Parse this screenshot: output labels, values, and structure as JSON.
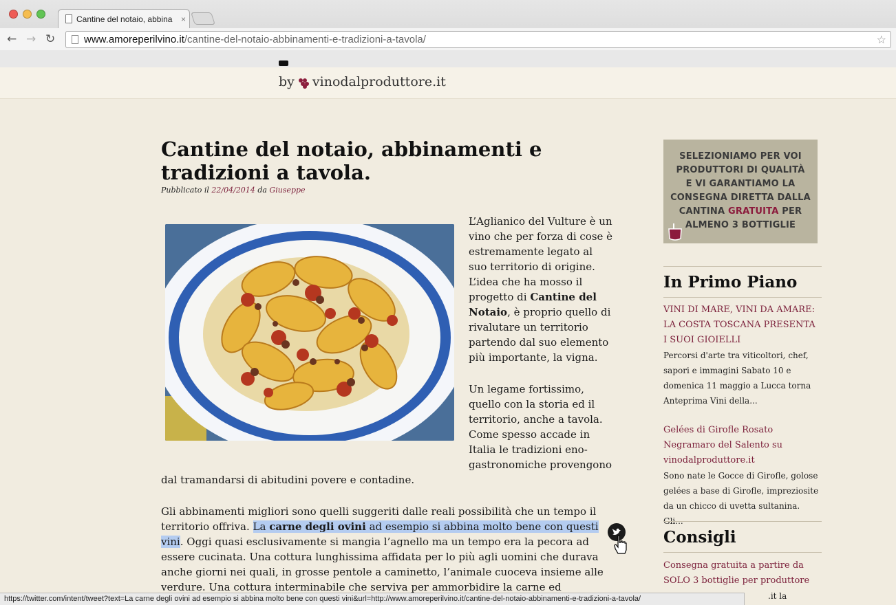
{
  "browser": {
    "tab_title": "Cantine del notaio, abbina",
    "tab_close": "×",
    "url_host": "www.amoreperilvino.it",
    "url_path": "/cantine-del-notaio-abbinamenti-e-tradizioni-a-tavola/",
    "back_icon": "←",
    "forward_icon": "→",
    "reload_icon": "↻",
    "star_icon": "☆"
  },
  "site": {
    "brand_by": "by",
    "brand_name": "vinodalproduttore.it"
  },
  "article": {
    "title": "Cantine del notaio, abbinamenti e tradizioni a tavola.",
    "meta_prefix": "Pubblicato il",
    "date": "22/04/2014",
    "meta_by": "da",
    "author": "Giuseppe",
    "p1_a": "L’Aglianico del Vulture è un vino che per forza di cose è estremamente legato al suo territorio di origine. L’idea che ha mosso il progetto di",
    "p1_bold": "Cantine del Notaio",
    "p1_b": ", è proprio quello di rivalutare un territorio partendo dal suo elemento più importante, la vigna.",
    "p2_col": "Un legame fortissimo, quello con la storia ed il territorio, anche a tavola. Come spesso accade in Italia le tradizioni eno-gastronomiche provengono",
    "p2_tail": "dal tramandarsi di abitudini povere e contadine.",
    "p3_a": "Gli abbinamenti migliori sono quelli suggeriti dalle reali possibilità che un tempo il territorio offriva.",
    "p3_hl_a": "La",
    "p3_hl_bold": "carne degli ovini",
    "p3_hl_b": "ad esempio si abbina molto bene con questi vini",
    "p3_b": ". Oggi quasi esclusivamente si mangia l’agnello ma un tempo era la pecora ad essere cucinata. Una cottura lunghissima affidata per lo più agli uomini che durava anche giorni nei quali, in grosse pentole a caminetto, l’animale cuoceva insieme alle verdure. Una cottura interminabile che serviva per ammorbidire la carne ed eliminare il tipico forte"
  },
  "promo": {
    "line1": "SELEZIONIAMO PER VOI",
    "line2": "PRODUTTORI DI QUALITÀ",
    "line3": "E VI GARANTIAMO LA",
    "line4": "CONSEGNA DIRETTA DALLA",
    "line5_a": "CANTINA",
    "line5_accent": "GRATUITA",
    "line5_b": "PER",
    "line6": "ALMENO 3 BOTTIGLIE"
  },
  "sidebar": {
    "primo_heading": "In Primo Piano",
    "post1_title": "VINI DI MARE, VINI DA AMARE: LA COSTA TOSCANA PRESENTA I SUOI GIOIELLI",
    "post1_excerpt": "Percorsi d'arte tra viticoltori, chef, sapori e immagini Sabato 10 e domenica 11 maggio a Lucca torna Anteprima Vini della...",
    "post2_title": "Gelées di Girofle Rosato Negramaro del Salento su vinodalproduttore.it",
    "post2_excerpt": "Sono nate le Gocce di Girofle, golose gelées a base di Girofle, impreziosite da un chicco di uvetta sultanina. Gli...",
    "consigli_heading": "Consigli",
    "consiglio1_title": "Consegna gratuita a partire da SOLO 3 bottiglie per produttore",
    "consiglio1_excerpt": ".it la consegna è"
  },
  "status_url": "https://twitter.com/intent/tweet?text=La carne degli ovini ad esempio si abbina molto bene con questi vini&url=http://www.amoreperilvino.it/cantine-del-notaio-abbinamenti-e-tradizioni-a-tavola/",
  "tweet_icon": "twitter-bird-icon",
  "colors": {
    "accent": "#7b1f3a",
    "page_bg": "#f1ece0",
    "selection": "#b4ccf0",
    "promo_bg": "#b9b49f"
  }
}
